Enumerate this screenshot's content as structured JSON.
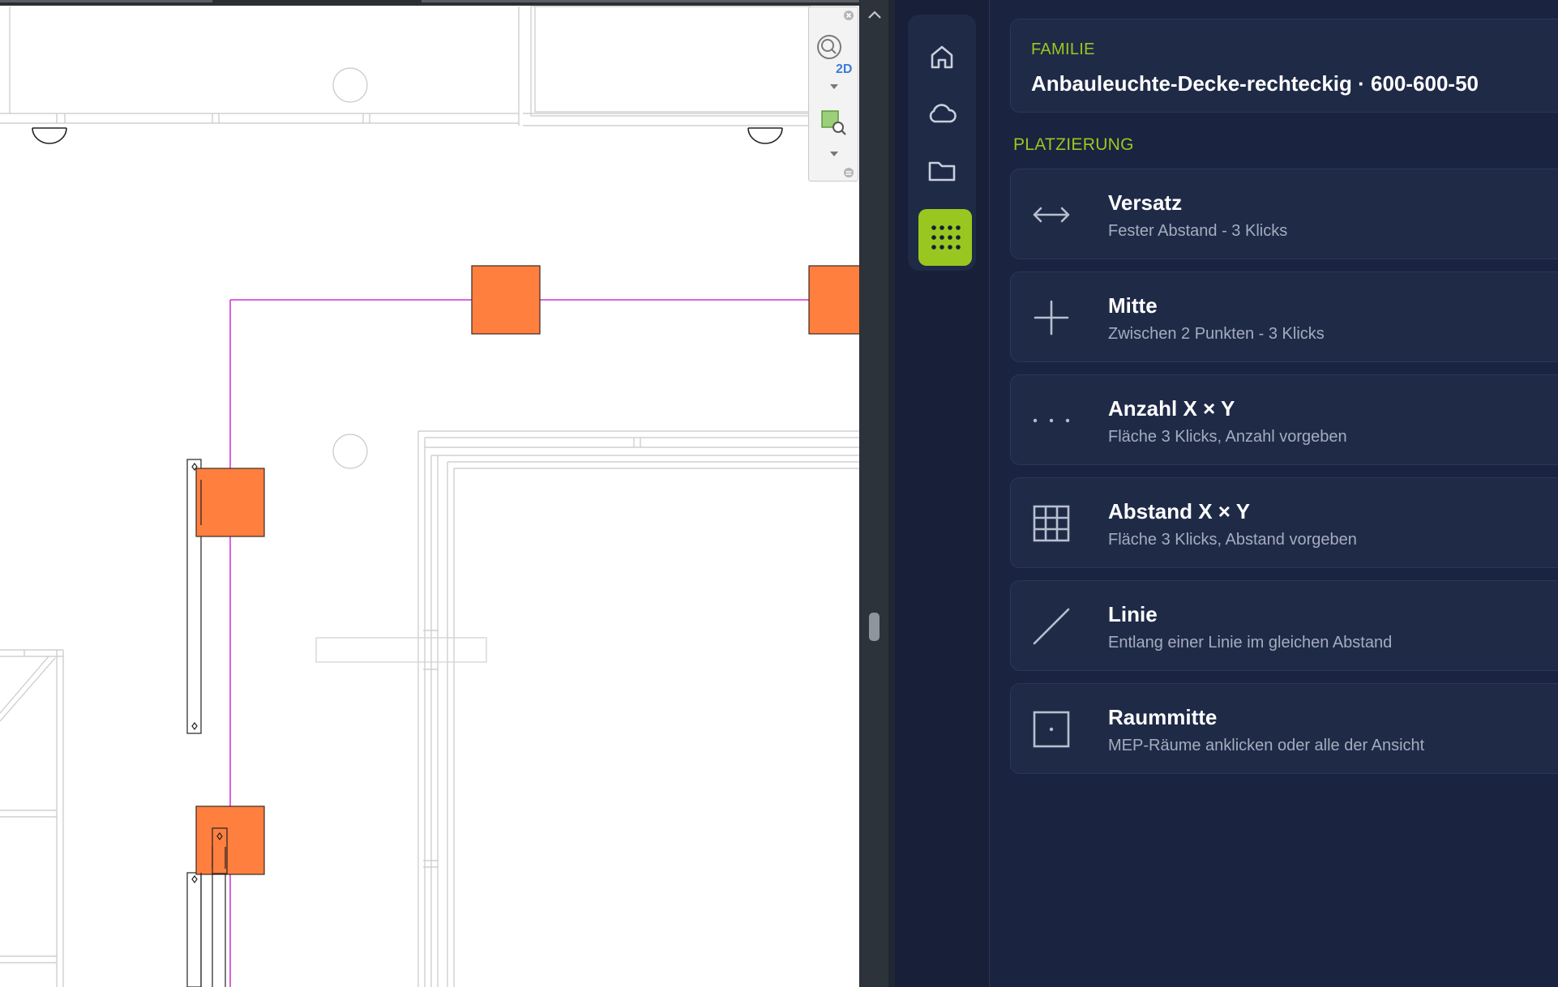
{
  "viewport": {
    "navbar": {
      "zoom_label": "2D"
    }
  },
  "rail": {
    "items": [
      {
        "icon": "home-icon"
      },
      {
        "icon": "cloud-icon"
      },
      {
        "icon": "folder-icon"
      },
      {
        "icon": "dots-grid-icon",
        "active": true
      }
    ],
    "accent": "#9ac71f"
  },
  "family": {
    "label": "FAMILIE",
    "name": "Anbauleuchte-Decke-rechteckig · 600-600-50"
  },
  "placement": {
    "label": "PLATZIERUNG",
    "options": [
      {
        "icon": "double-arrow-icon",
        "title": "Versatz",
        "subtitle": "Fester Abstand - 3 Klicks"
      },
      {
        "icon": "plus-icon",
        "title": "Mitte",
        "subtitle": "Zwischen 2 Punkten - 3 Klicks"
      },
      {
        "icon": "dots-row-icon",
        "title": "Anzahl X × Y",
        "subtitle": "Fläche 3 Klicks, Anzahl vorgeben"
      },
      {
        "icon": "grid-icon",
        "title": "Abstand X × Y",
        "subtitle": "Fläche 3 Klicks, Abstand vorgeben"
      },
      {
        "icon": "diagonal-line-icon",
        "title": "Linie",
        "subtitle": "Entlang einer Linie im gleichen Abstand"
      },
      {
        "icon": "room-center-icon",
        "title": "Raummitte",
        "subtitle": "MEP-Räume anklicken oder alle der Ansicht"
      }
    ]
  },
  "colors": {
    "fixture": "#ff7f3f",
    "guide_line": "#d12fd1",
    "panel_bg": "#1a2340",
    "card_bg": "#1f2a47"
  }
}
